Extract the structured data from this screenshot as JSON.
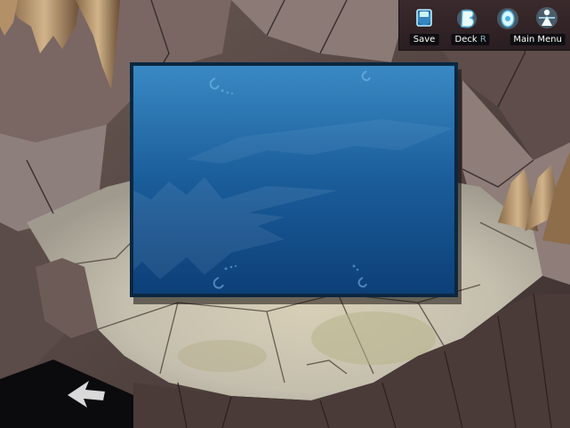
{
  "toolbar": {
    "save_label": "Save",
    "deck_label": "Deck",
    "hidden_label": "R",
    "main_menu_label": "Main Menu"
  },
  "colors": {
    "card_top": "#3a89c4",
    "card_bottom": "#0d3f78",
    "card_border": "#0b2740",
    "toolbar_bg": "#2e2024",
    "label_bg": "#0e0e12",
    "icon_glow": "#9fe4ff"
  },
  "icons": {
    "save": "save-icon",
    "deck": "deck-icon",
    "main_menu": "main-menu-icon",
    "back": "back-arrow-icon"
  }
}
